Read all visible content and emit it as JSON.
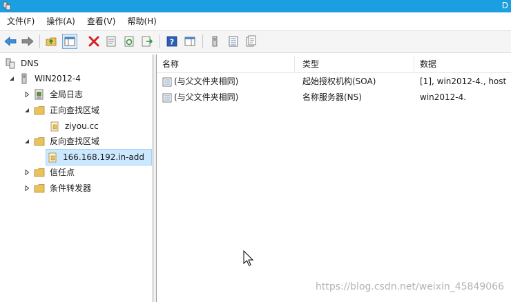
{
  "window": {
    "title_fragment": "D"
  },
  "menu": [
    "文件(F)",
    "操作(A)",
    "查看(V)",
    "帮助(H)"
  ],
  "tree": {
    "root": "DNS",
    "server": "WIN2012-4",
    "items": [
      {
        "label": "全局日志",
        "expander": "collapsed"
      },
      {
        "label": "正向查找区域",
        "expander": "expanded"
      },
      {
        "label": "ziyou.cc",
        "expander": "none"
      },
      {
        "label": "反向查找区域",
        "expander": "expanded"
      },
      {
        "label": "166.168.192.in-add",
        "expander": "none",
        "selected": true
      },
      {
        "label": "信任点",
        "expander": "collapsed"
      },
      {
        "label": "条件转发器",
        "expander": "collapsed"
      }
    ]
  },
  "list": {
    "columns": [
      "名称",
      "类型",
      "数据"
    ],
    "rows": [
      {
        "name": "(与父文件夹相同)",
        "type": "起始授权机构(SOA)",
        "data": "[1], win2012-4., host"
      },
      {
        "name": "(与父文件夹相同)",
        "type": "名称服务器(NS)",
        "data": "win2012-4."
      }
    ]
  },
  "watermark": "https://blog.csdn.net/weixin_45849066",
  "colors": {
    "titlebar": "#1c9fe0",
    "selection": "#cce8ff",
    "folder": "#e8c25a"
  },
  "icons": [
    "dns-icon",
    "server-icon",
    "log-icon",
    "folder-icon",
    "zone-icon",
    "record-icon"
  ]
}
